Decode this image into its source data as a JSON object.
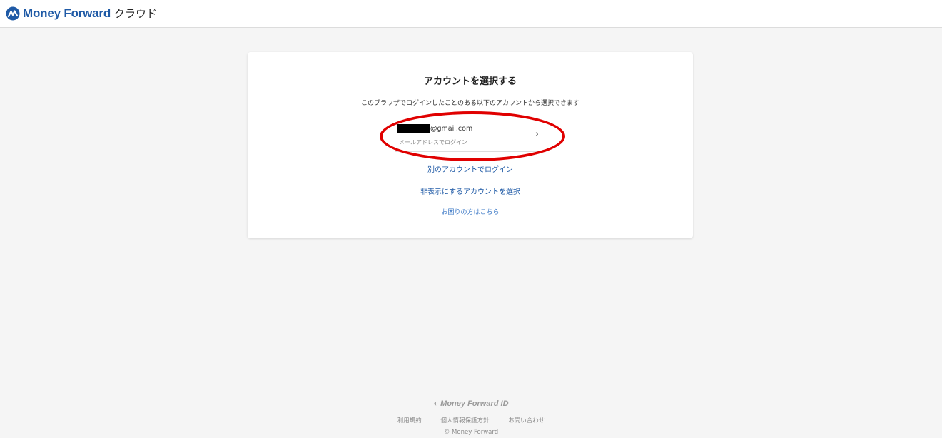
{
  "header": {
    "brand": "Money Forward",
    "brand_suffix": "クラウド"
  },
  "card": {
    "title": "アカウントを選択する",
    "description": "このブラウザでログインしたことのある以下のアカウントから選択できます",
    "account": {
      "email_domain": "@gmail.com",
      "method": "メールアドレスでログイン",
      "chevron_icon": "chevron-right-icon"
    },
    "links": {
      "other_account": "別のアカウントでログイン",
      "hide_accounts": "非表示にするアカウントを選択",
      "help": "お困りの方はこちら"
    }
  },
  "footer": {
    "brand": "Money Forward ID",
    "links": [
      "利用規約",
      "個人情報保護方針",
      "お問い合わせ"
    ],
    "copyright": "© Money Forward"
  },
  "colors": {
    "brand_blue": "#1f5aa6",
    "highlight_red": "#e00000",
    "background": "#f5f5f5"
  }
}
